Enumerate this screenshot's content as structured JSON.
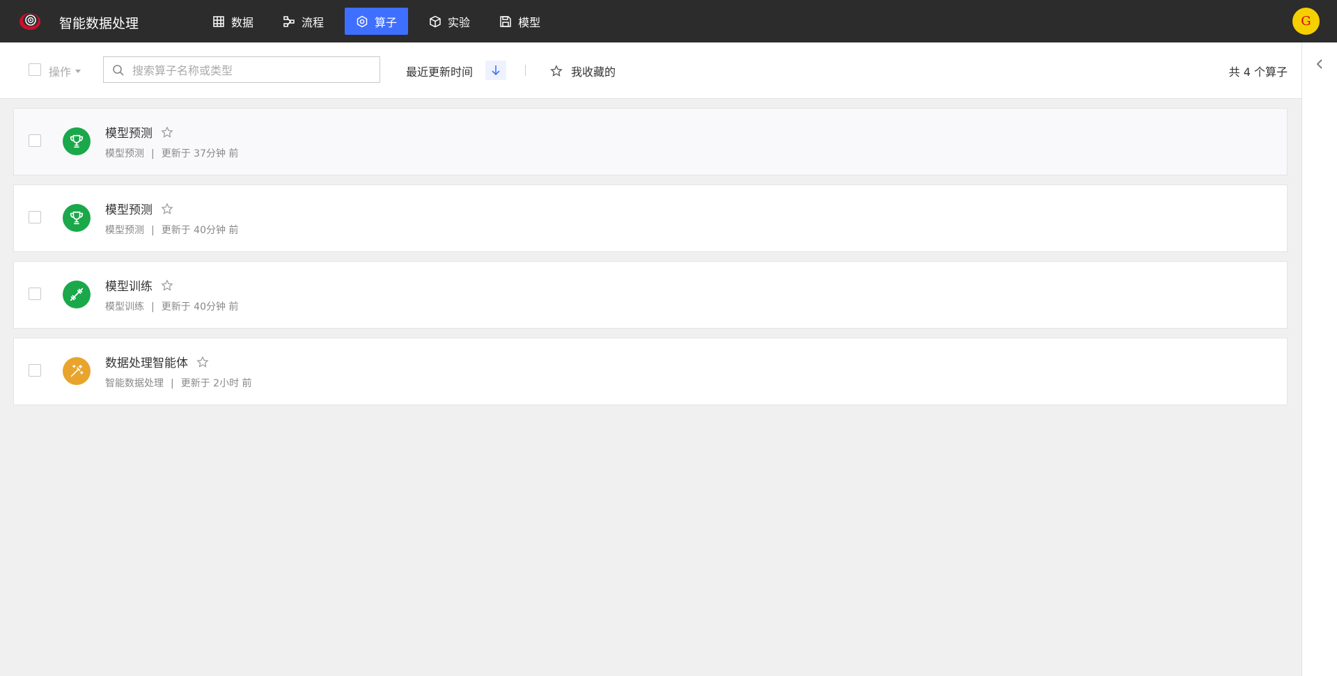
{
  "app": {
    "title": "智能数据处理",
    "logo_icon": "eye-logo-icon"
  },
  "nav": {
    "items": [
      {
        "key": "data",
        "label": "数据",
        "icon": "table-icon",
        "active": false
      },
      {
        "key": "flow",
        "label": "流程",
        "icon": "flow-icon",
        "active": false
      },
      {
        "key": "operator",
        "label": "算子",
        "icon": "hexagon-icon",
        "active": true
      },
      {
        "key": "experiment",
        "label": "实验",
        "icon": "cube-icon",
        "active": false
      },
      {
        "key": "model",
        "label": "模型",
        "icon": "save-icon",
        "active": false
      }
    ],
    "active_color": "#3f6fff"
  },
  "user": {
    "avatar_letter": "G",
    "avatar_bg": "#f5d000",
    "avatar_fg": "#d0021b"
  },
  "toolbar": {
    "ops_label": "操作",
    "search_placeholder": "搜索算子名称或类型",
    "sort_label": "最近更新时间",
    "sort_direction_icon": "arrow-down-icon",
    "favorites_label": "我收藏的",
    "count_label": "共 4 个算子"
  },
  "operators": [
    {
      "name": "模型预测",
      "type": "模型预测",
      "updated": "更新于 37分钟 前",
      "icon": "trophy-icon",
      "icon_color": "#1aa84a"
    },
    {
      "name": "模型预测",
      "type": "模型预测",
      "updated": "更新于 40分钟 前",
      "icon": "trophy-icon",
      "icon_color": "#1aa84a"
    },
    {
      "name": "模型训练",
      "type": "模型训练",
      "updated": "更新于 40分钟 前",
      "icon": "dumbbell-icon",
      "icon_color": "#1aa84a"
    },
    {
      "name": "数据处理智能体",
      "type": "智能数据处理",
      "updated": "更新于 2小时 前",
      "icon": "magic-wand-icon",
      "icon_color": "#e8a42c"
    }
  ]
}
